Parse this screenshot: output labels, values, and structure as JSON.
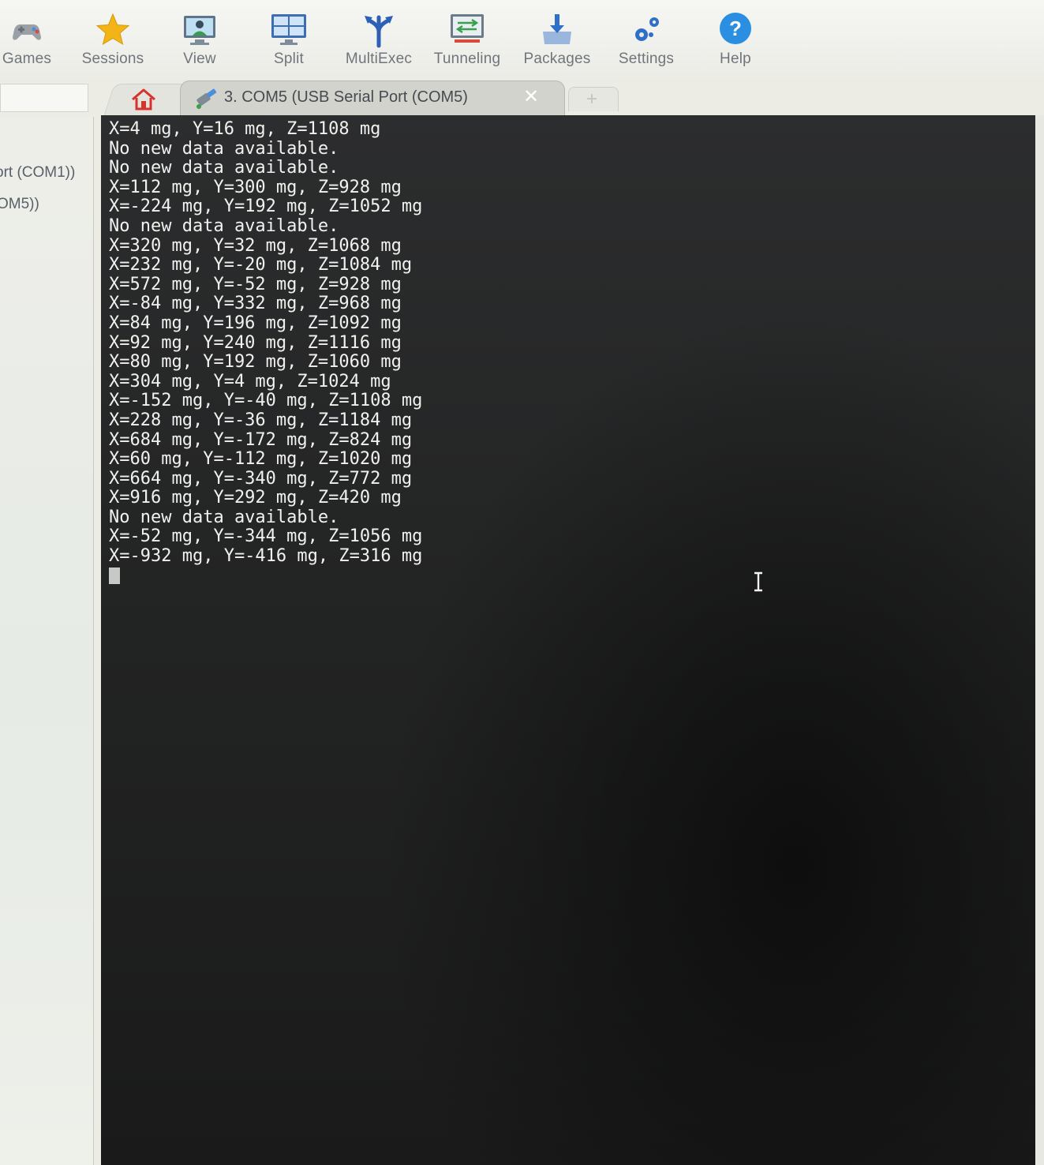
{
  "toolbar": {
    "items": [
      {
        "label": "Games",
        "icon": "gamepad-icon"
      },
      {
        "label": "Sessions",
        "icon": "star-icon"
      },
      {
        "label": "View",
        "icon": "monitor-user-icon"
      },
      {
        "label": "Split",
        "icon": "split-screen-icon"
      },
      {
        "label": "MultiExec",
        "icon": "fork-arrows-icon"
      },
      {
        "label": "Tunneling",
        "icon": "tunnel-monitor-icon"
      },
      {
        "label": "Packages",
        "icon": "download-package-icon"
      },
      {
        "label": "Settings",
        "icon": "gears-icon"
      },
      {
        "label": "Help",
        "icon": "question-circle-icon"
      }
    ]
  },
  "sessions": {
    "items": [
      {
        "label": "ort (COM1))"
      },
      {
        "label": "OM5))"
      }
    ]
  },
  "tabs": {
    "home_icon": "home-icon",
    "active": {
      "title": "3. COM5  (USB Serial Port (COM5)",
      "close": "✕",
      "icon": "serial-plug-icon"
    },
    "new_tab": "+"
  },
  "terminal": {
    "lines": [
      "X=4 mg, Y=16 mg, Z=1108 mg",
      "No new data available.",
      "No new data available.",
      "X=112 mg, Y=300 mg, Z=928 mg",
      "X=-224 mg, Y=192 mg, Z=1052 mg",
      "No new data available.",
      "X=320 mg, Y=32 mg, Z=1068 mg",
      "X=232 mg, Y=-20 mg, Z=1084 mg",
      "X=572 mg, Y=-52 mg, Z=928 mg",
      "X=-84 mg, Y=332 mg, Z=968 mg",
      "X=84 mg, Y=196 mg, Z=1092 mg",
      "X=92 mg, Y=240 mg, Z=1116 mg",
      "X=80 mg, Y=192 mg, Z=1060 mg",
      "X=304 mg, Y=4 mg, Z=1024 mg",
      "X=-152 mg, Y=-40 mg, Z=1108 mg",
      "X=228 mg, Y=-36 mg, Z=1184 mg",
      "X=684 mg, Y=-172 mg, Z=824 mg",
      "X=60 mg, Y=-112 mg, Z=1020 mg",
      "X=664 mg, Y=-340 mg, Z=772 mg",
      "X=916 mg, Y=292 mg, Z=420 mg",
      "No new data available.",
      "X=-52 mg, Y=-344 mg, Z=1056 mg",
      "X=-932 mg, Y=-416 mg, Z=316 mg"
    ]
  },
  "colors": {
    "terminal_bg": "#232424",
    "terminal_fg": "#f1f1ef",
    "help_blue": "#2a8fe0",
    "home_red": "#d8322c"
  }
}
